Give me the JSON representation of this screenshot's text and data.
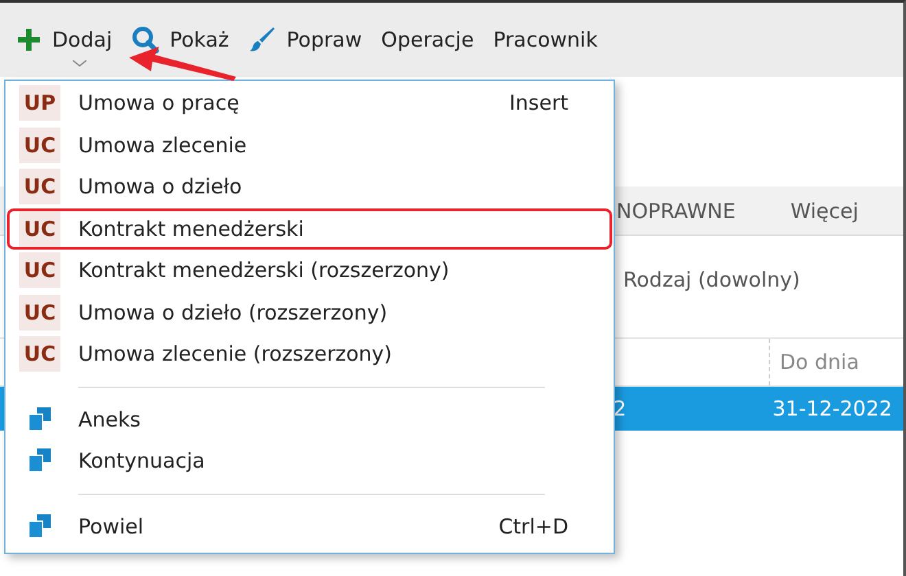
{
  "toolbar": [
    {
      "label": "Dodaj",
      "dropdown": true
    },
    {
      "label": "Pokaż",
      "dropdown": false
    },
    {
      "label": "Popraw",
      "dropdown": false
    },
    {
      "label": "Operacje",
      "dropdown": false
    },
    {
      "label": "Pracownik",
      "dropdown": false
    }
  ],
  "tabs": [
    {
      "label": "NOPRAWNE"
    },
    {
      "label": "Więcej"
    }
  ],
  "filter": "Rodzaj (dowolny)",
  "table": {
    "columns": [
      "",
      "Do dnia"
    ],
    "rows": [
      {
        "cells": [
          "2",
          "31-12-2022"
        ],
        "selected": true
      }
    ]
  },
  "menu": {
    "items": [
      {
        "kind": "contract",
        "badge": "UP",
        "label": "Umowa o pracę",
        "shortcut": "Insert",
        "highlighted": false
      },
      {
        "kind": "contract",
        "badge": "UC",
        "label": "Umowa zlecenie",
        "highlighted": false
      },
      {
        "kind": "contract",
        "badge": "UC",
        "label": "Umowa o dzieło",
        "highlighted": false
      },
      {
        "kind": "contract",
        "badge": "UC",
        "label": "Kontrakt menedżerski",
        "highlighted": true
      },
      {
        "kind": "contract",
        "badge": "UC",
        "label": "Kontrakt menedżerski (rozszerzony)",
        "highlighted": false
      },
      {
        "kind": "contract",
        "badge": "UC",
        "label": "Umowa o dzieło (rozszerzony)",
        "highlighted": false
      },
      {
        "kind": "contract",
        "badge": "UC",
        "label": "Umowa zlecenie (rozszerzony)",
        "highlighted": false
      },
      {
        "kind": "separator"
      },
      {
        "kind": "document",
        "label": "Aneks",
        "highlighted": false
      },
      {
        "kind": "document",
        "label": "Kontynuacja",
        "highlighted": false
      },
      {
        "kind": "separator"
      },
      {
        "kind": "document",
        "label": "Powiel",
        "shortcut": "Ctrl+D",
        "highlighted": false
      }
    ]
  },
  "annotation": {
    "arrow": true
  }
}
